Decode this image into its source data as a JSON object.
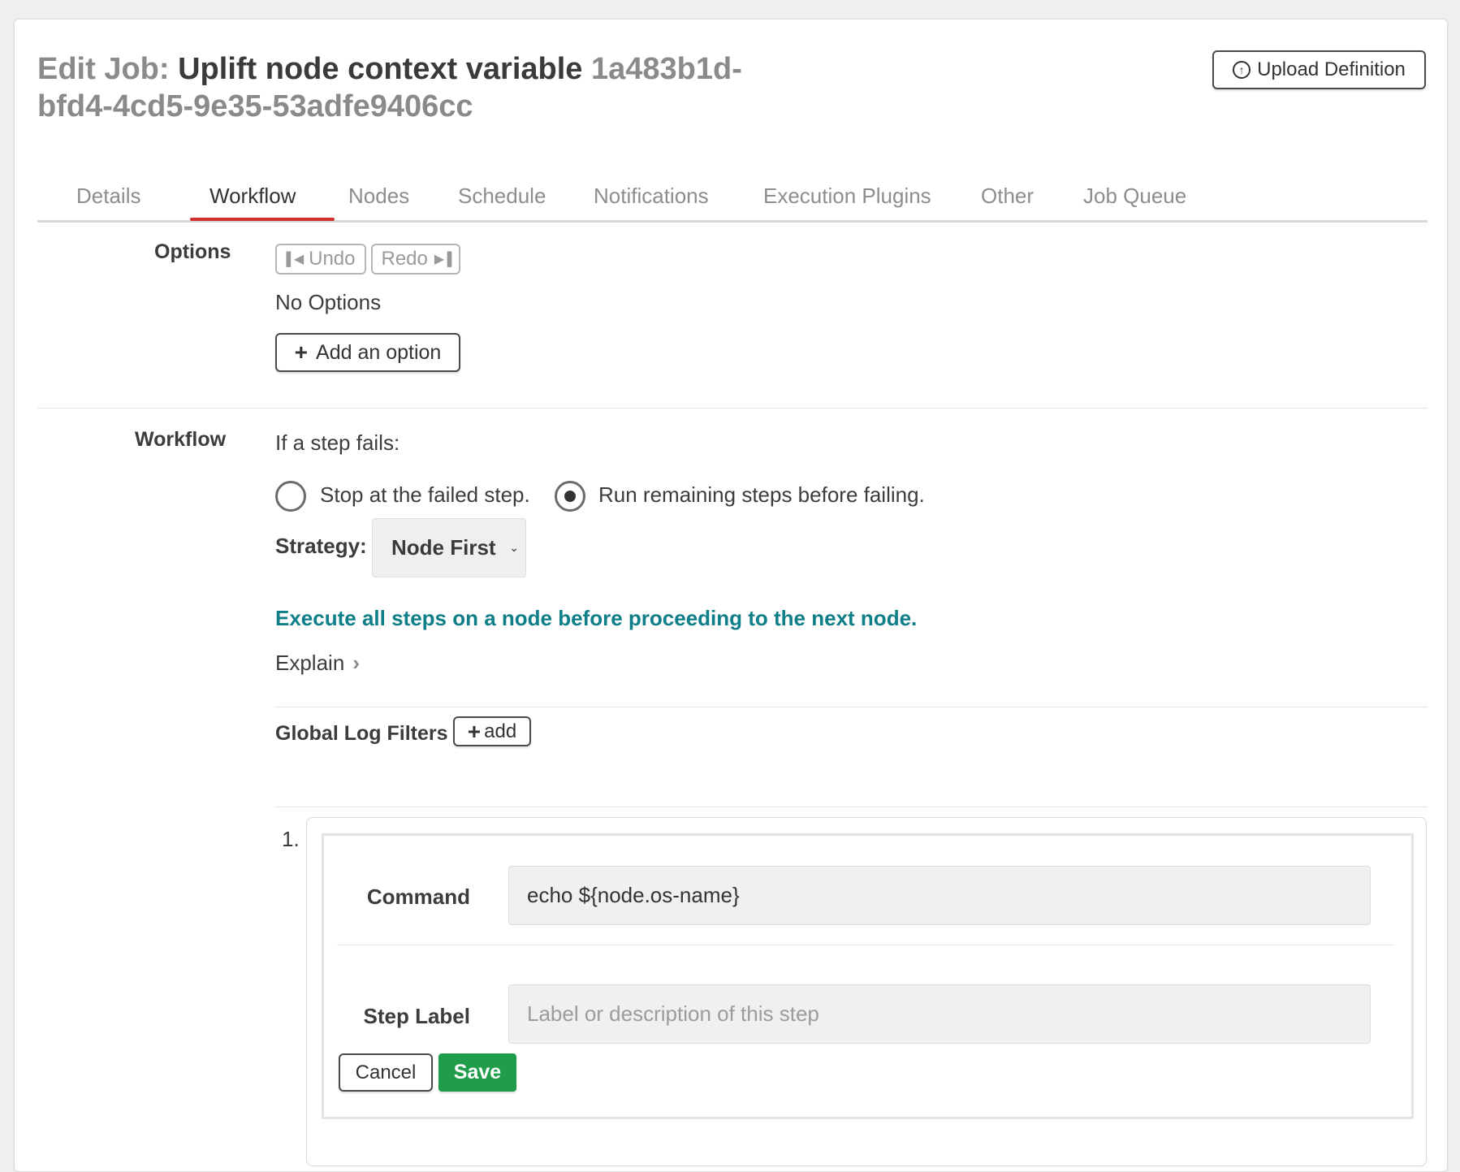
{
  "header": {
    "prefix": "Edit Job:",
    "job_name": "Uplift node context variable",
    "job_id": "1a483b1d-bfd4-4cd5-9e35-53adfe9406cc",
    "upload_label": "Upload Definition"
  },
  "tabs": [
    {
      "label": "Details"
    },
    {
      "label": "Workflow",
      "active": true
    },
    {
      "label": "Nodes"
    },
    {
      "label": "Schedule"
    },
    {
      "label": "Notifications"
    },
    {
      "label": "Execution Plugins"
    },
    {
      "label": "Other"
    },
    {
      "label": "Job Queue"
    }
  ],
  "options": {
    "label": "Options",
    "undo_label": "Undo",
    "redo_label": "Redo",
    "empty_text": "No Options",
    "add_label": "Add an option"
  },
  "workflow": {
    "label": "Workflow",
    "fail_prompt": "If a step fails:",
    "radio_stop": "Stop at the failed step.",
    "radio_run": "Run remaining steps before failing.",
    "selected_radio": "run",
    "strategy_label": "Strategy:",
    "strategy_value": "Node First",
    "strategy_description": "Execute all steps on a node before proceeding to the next node.",
    "explain_label": "Explain",
    "log_filters_label": "Global Log Filters",
    "add_filter_label": "add"
  },
  "step": {
    "number": "1.",
    "command_label": "Command",
    "command_value": "echo ${node.os-name}",
    "step_label_label": "Step Label",
    "step_label_placeholder": "Label or description of this step",
    "cancel_label": "Cancel",
    "save_label": "Save"
  },
  "colors": {
    "accent_tab": "#d32f2f",
    "strategy_text": "#0e7f88",
    "save_button": "#1f9d4a"
  }
}
